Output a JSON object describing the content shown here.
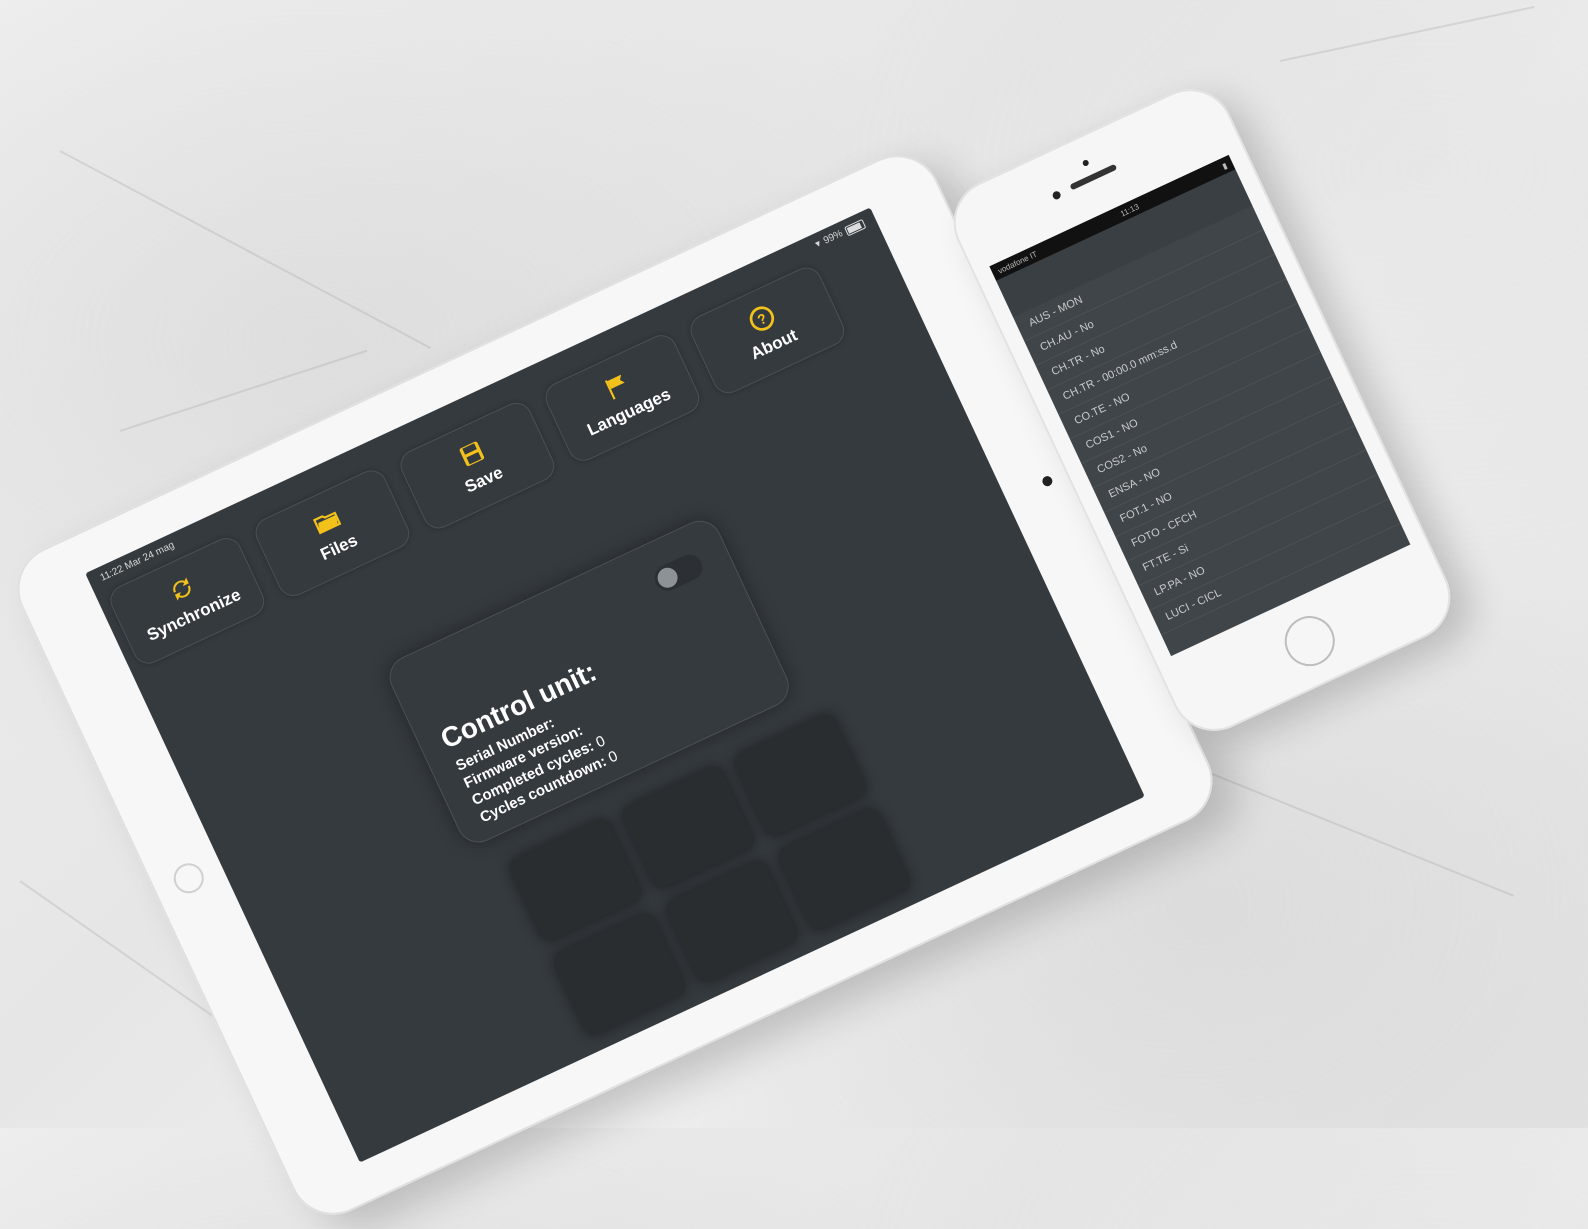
{
  "tablet": {
    "status": {
      "time": "11:22",
      "date": "Mar 24 mag",
      "battery": "99%"
    },
    "toolbar": [
      {
        "label": "Synchronize",
        "icon": "sync-icon"
      },
      {
        "label": "Files",
        "icon": "folder-icon"
      },
      {
        "label": "Save",
        "icon": "save-icon"
      },
      {
        "label": "Languages",
        "icon": "flag-icon"
      },
      {
        "label": "About",
        "icon": "help-icon"
      }
    ],
    "control_unit": {
      "title": "Control unit:",
      "serial_label": "Serial Number:",
      "firmware_label": "Firmware version:",
      "completed_label": "Completed cycles:",
      "completed_value": "0",
      "countdown_label": "Cycles countdown:",
      "countdown_value": "0"
    },
    "accent_color": "#f2c21b"
  },
  "phone": {
    "status": {
      "carrier": "vodafone IT",
      "time": "11:13"
    },
    "parameters": [
      "AUS - MON",
      "CH.AU - No",
      "CH.TR - No",
      "CH.TR - 00:00.0 mm:ss.d",
      "CO.TE - NO",
      "COS1 - NO",
      "COS2 - No",
      "ENSA - NO",
      "FOT.1 - NO",
      "FOTO - CFCH",
      "FT.TE - Si",
      "LP.PA - NO",
      "LUCI - CICL"
    ]
  }
}
